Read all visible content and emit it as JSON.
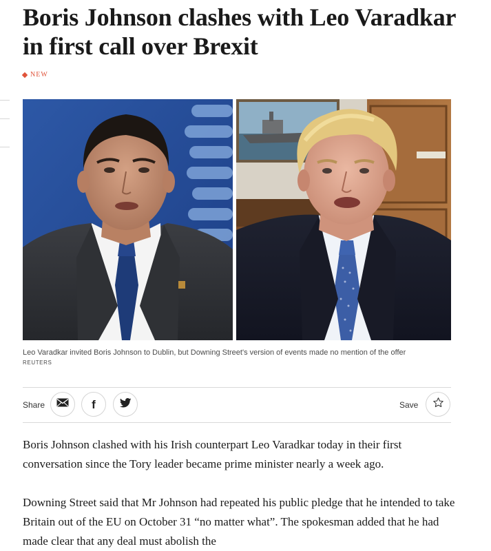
{
  "article": {
    "headline": "Boris Johnson clashes with Leo Varadkar in first call over Brexit",
    "badge": "NEW",
    "accent_color": "#e0533a",
    "images": [
      {
        "alt": "Leo Varadkar"
      },
      {
        "alt": "Boris Johnson"
      }
    ],
    "caption": "Leo Varadkar invited Boris Johnson to Dublin, but Downing Street's version of events made no mention of the offer",
    "credit": "REUTERS",
    "share": {
      "label": "Share",
      "buttons": [
        {
          "icon": "envelope-icon"
        },
        {
          "icon": "facebook-icon"
        },
        {
          "icon": "twitter-icon"
        }
      ]
    },
    "save": {
      "label": "Save",
      "icon": "star-icon"
    },
    "paragraphs": [
      "Boris Johnson clashed with his Irish counterpart Leo Varadkar today in their first conversation since the Tory leader became prime minister nearly a week ago.",
      "Downing Street said that Mr Johnson had repeated his public pledge that he intended to take Britain out of the EU on October 31 “no matter what”. The spokesman added that he had made clear that any deal must abolish the"
    ]
  }
}
